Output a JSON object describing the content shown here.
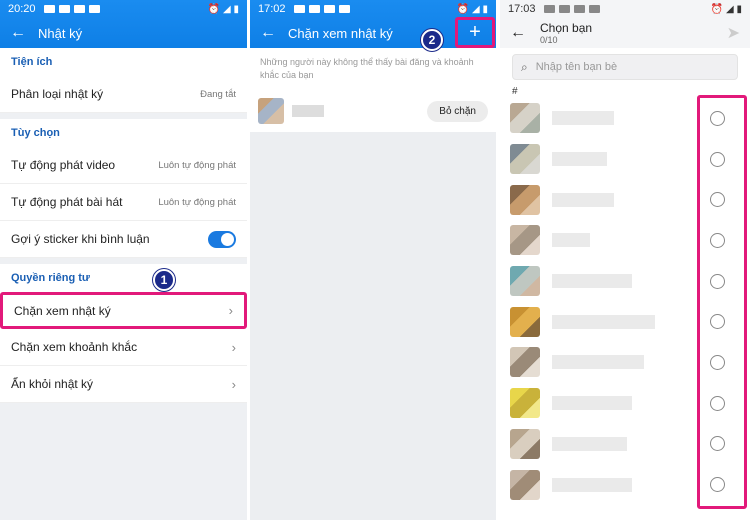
{
  "panel1": {
    "time": "20:20",
    "title": "Nhật ký",
    "sections": [
      {
        "header": "Tiện ích",
        "rows": [
          {
            "label": "Phân loại nhật ký",
            "value": "Đang tắt"
          }
        ]
      },
      {
        "header": "Tùy chọn",
        "rows": [
          {
            "label": "Tự động phát video",
            "value": "Luôn tự động phát"
          },
          {
            "label": "Tự động phát bài hát",
            "value": "Luôn tự động phát"
          },
          {
            "label": "Gợi ý sticker khi bình luận",
            "value": ""
          }
        ]
      },
      {
        "header": "Quyền riêng tư",
        "rows": [
          {
            "label": "Chặn xem nhật ký",
            "value": ""
          },
          {
            "label": "Chặn xem khoảnh khắc",
            "value": ""
          },
          {
            "label": "Ẩn khỏi nhật ký",
            "value": ""
          }
        ]
      }
    ],
    "step_badge": "1",
    "toggle_on": true
  },
  "panel2": {
    "time": "17:02",
    "title": "Chặn xem nhật ký",
    "note": "Những người này không thể thấy bài đăng và khoảnh khắc của bạn",
    "unblock_label": "Bỏ chặn",
    "step_badge": "2",
    "add_icon": "+"
  },
  "panel3": {
    "time": "17:03",
    "title": "Chọn bạn",
    "count": "0/10",
    "search_placeholder": "Nhập tên bạn bè",
    "section_letter": "#"
  },
  "colors": {
    "accent": "#1a8cf0",
    "highlight": "#e2197a",
    "badge": "#1b2a8a"
  }
}
